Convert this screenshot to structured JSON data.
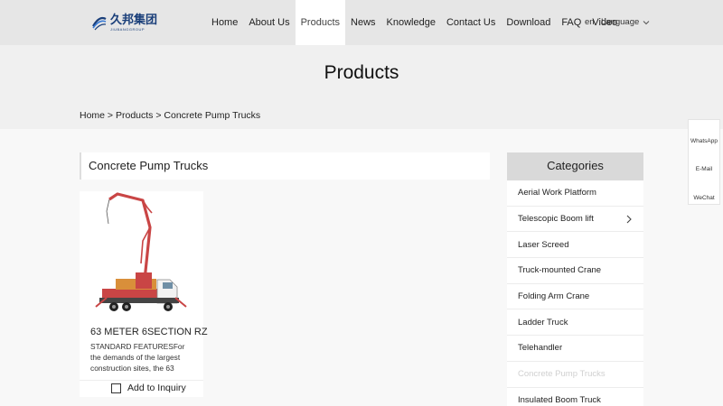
{
  "logo": {
    "cn": "久邦集团",
    "en": "JIUBANGGROUP"
  },
  "nav": {
    "items": [
      "Home",
      "About Us",
      "Products",
      "News",
      "Knowledge",
      "Contact Us",
      "Download",
      "FAQ",
      "Video"
    ],
    "active": "Products",
    "lang_short": "en",
    "lang_label": "Language"
  },
  "banner": {
    "title": "Products"
  },
  "breadcrumb": {
    "home": "Home",
    "sep1": " > ",
    "products": "Products",
    "sep2": " > ",
    "current": "Concrete Pump Trucks"
  },
  "section": {
    "title": "Concrete Pump Trucks"
  },
  "product": {
    "name": "63 METER 6SECTION RZ",
    "desc": "STANDARD FEATURESFor the demands of the largest construction sites, the 63",
    "inquiry_label": "Add to Inquiry"
  },
  "categories": {
    "title": "Categories",
    "items": [
      "Aerial Work Platform",
      "Telescopic Boom lift",
      "Laser Screed",
      "Truck-mounted Crane",
      "Folding Arm Crane",
      "Ladder Truck",
      "Telehandler",
      "Concrete Pump Trucks",
      "Insulated Boom Truck"
    ],
    "current": "Concrete Pump Trucks"
  },
  "side_contact": {
    "whatsapp": "WhatsApp",
    "email": "E-Mail",
    "wechat": "WeChat"
  },
  "colors": {
    "header_bg": "#e6e6e6",
    "brand_blue": "#1a3f7a",
    "boom_red": "#c94545",
    "cat_head_bg": "#d9d9d9"
  }
}
